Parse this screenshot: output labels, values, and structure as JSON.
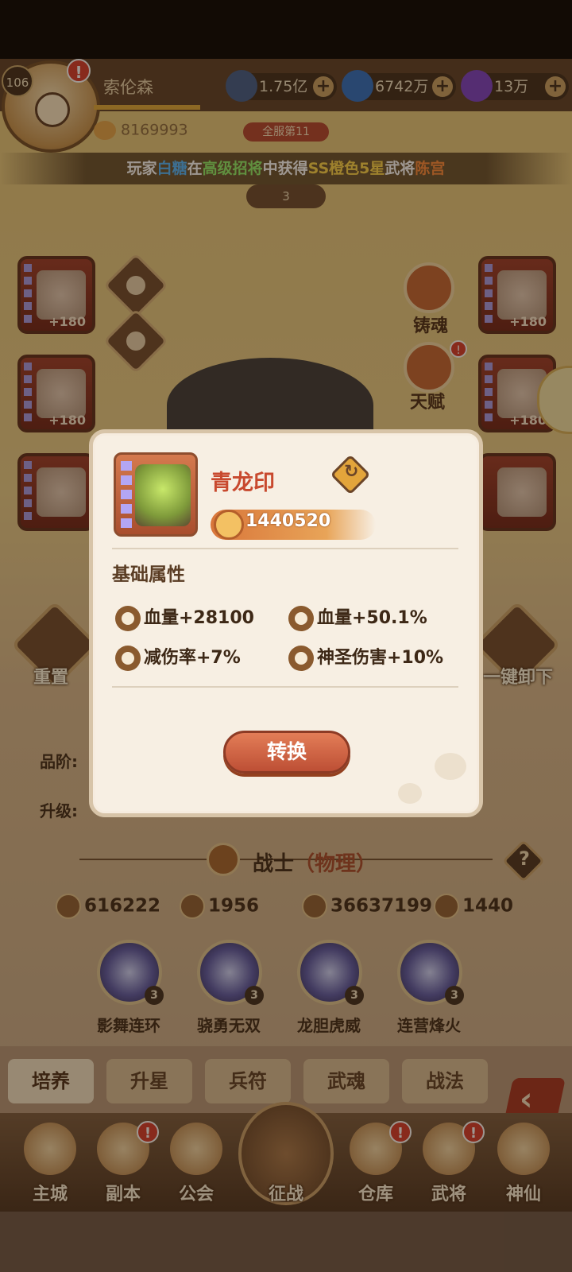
{
  "player": {
    "level": "106",
    "name": "索伦森",
    "paw_score": "8169993",
    "rank": "全服第11",
    "star_level": "3"
  },
  "currencies": [
    {
      "value": "1.75亿",
      "icon": "coin-icon",
      "color": "#3e5c8a"
    },
    {
      "value": "6742万",
      "icon": "orb-icon",
      "color": "#2a6ec4"
    },
    {
      "value": "13万",
      "icon": "crystal-icon",
      "color": "#7b3fc6"
    }
  ],
  "marquee": {
    "p1": "玩家",
    "player": "白糖",
    "p2": "在",
    "source": "高级招将",
    "p3": "中获得",
    "quality": "SS橙色5星",
    "p4": "武将",
    "general": "陈宫"
  },
  "slots": {
    "left_top_plus": "+180",
    "left_mid_plus": "+180",
    "right_top_plus": "+180",
    "right_mid_plus": "+180"
  },
  "round_buttons": {
    "soul": "铸魂",
    "talent": "天赋"
  },
  "actions": {
    "reset": "重置",
    "unequip_all": "一键卸下"
  },
  "info": {
    "grade_label": "品阶:",
    "upgrade_label": "升级:"
  },
  "class": {
    "name": "战士",
    "type": "（物理）",
    "help": "?"
  },
  "stats": {
    "attack": "616222",
    "defense": "1956",
    "hp": "36637199",
    "speed": "1440"
  },
  "skills": [
    {
      "name": "影舞连环",
      "level": "3"
    },
    {
      "name": "骁勇无双",
      "level": "3"
    },
    {
      "name": "龙胆虎威",
      "level": "3"
    },
    {
      "name": "连营烽火",
      "level": "3"
    }
  ],
  "tabs": [
    "培养",
    "升星",
    "兵符",
    "武魂",
    "战法"
  ],
  "active_tab": "培养",
  "nav": [
    {
      "label": "主城",
      "alert": ""
    },
    {
      "label": "副本",
      "alert": "!"
    },
    {
      "label": "公会",
      "alert": ""
    },
    {
      "label": "征战",
      "alert": ""
    },
    {
      "label": "仓库",
      "alert": "!"
    },
    {
      "label": "武将",
      "alert": "!"
    },
    {
      "label": "神仙",
      "alert": ""
    }
  ],
  "modal": {
    "item_name": "青龙印",
    "power": "1440520",
    "section_title": "基础属性",
    "attrs": [
      "血量+28100",
      "血量+50.1%",
      "减伤率+7%",
      "神圣伤害+10%"
    ],
    "button": "转换"
  },
  "colors": {
    "accent_red": "#c8492e",
    "button": "#bd4f35",
    "marquee_blue": "#4fb6ff",
    "marquee_green": "#8ef06b",
    "marquee_yellow": "#ffd84a",
    "marquee_orange": "#ff8a3a"
  }
}
